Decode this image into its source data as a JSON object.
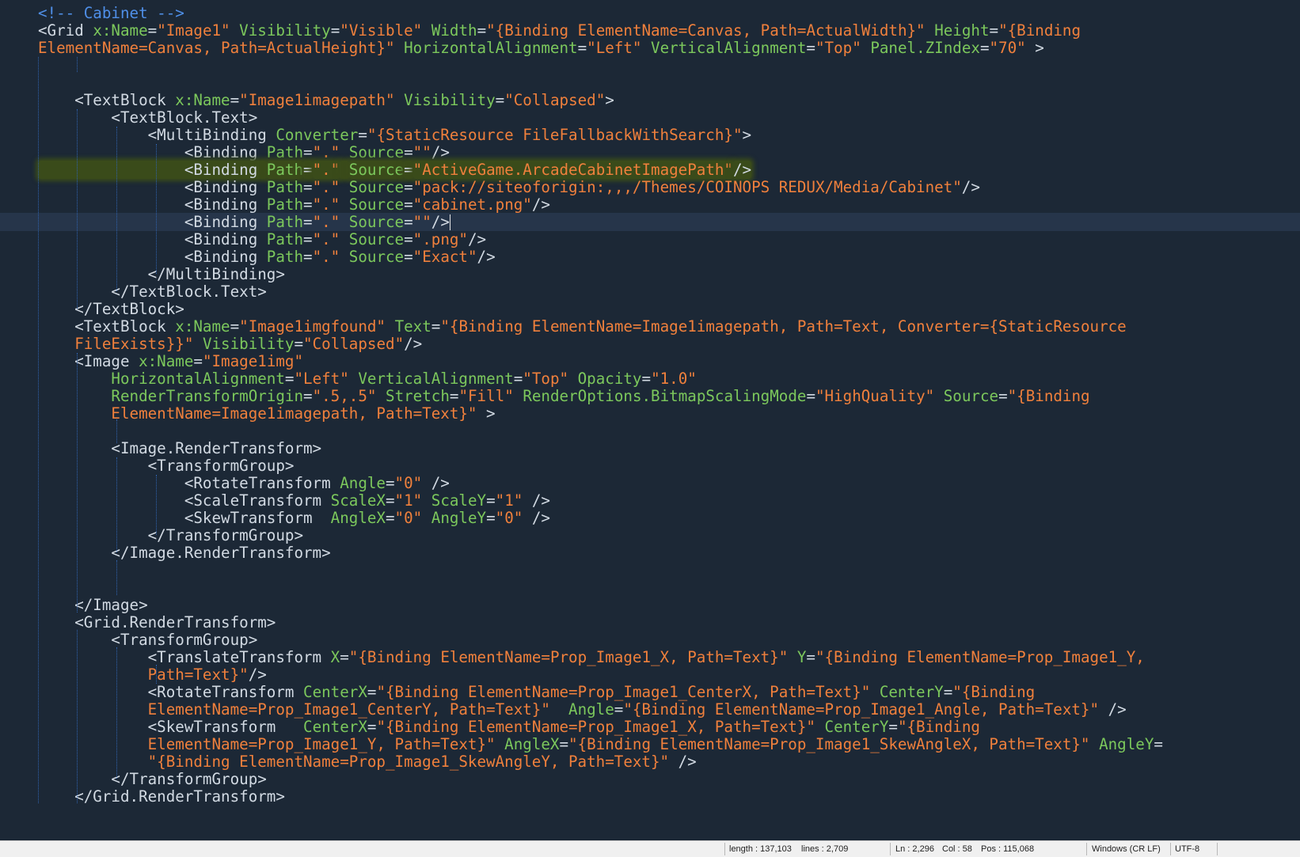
{
  "editor": {
    "lines": [
      [
        [
          "c",
          "<!-- Cabinet -->"
        ]
      ],
      [
        [
          "t",
          "<Grid "
        ],
        [
          "a",
          "x:Name"
        ],
        [
          "t",
          "="
        ],
        [
          "v",
          "\"Image1\""
        ],
        [
          "t",
          " "
        ],
        [
          "a",
          "Visibility"
        ],
        [
          "t",
          "="
        ],
        [
          "v",
          "\"Visible\""
        ],
        [
          "t",
          " "
        ],
        [
          "a",
          "Width"
        ],
        [
          "t",
          "="
        ],
        [
          "v",
          "\"{Binding ElementName=Canvas, Path=ActualWidth}\""
        ],
        [
          "t",
          " "
        ],
        [
          "a",
          "Height"
        ],
        [
          "t",
          "="
        ],
        [
          "v",
          "\"{Binding"
        ]
      ],
      [
        [
          "v",
          "ElementName=Canvas, Path=ActualHeight}\""
        ],
        [
          "t",
          " "
        ],
        [
          "a",
          "HorizontalAlignment"
        ],
        [
          "t",
          "="
        ],
        [
          "v",
          "\"Left\""
        ],
        [
          "t",
          " "
        ],
        [
          "a",
          "VerticalAlignment"
        ],
        [
          "t",
          "="
        ],
        [
          "v",
          "\"Top\""
        ],
        [
          "t",
          " "
        ],
        [
          "a",
          "Panel.ZIndex"
        ],
        [
          "t",
          "="
        ],
        [
          "v",
          "\"70\""
        ],
        [
          "t",
          " >"
        ]
      ],
      [],
      [],
      [
        [
          "t",
          "    <TextBlock "
        ],
        [
          "a",
          "x:Name"
        ],
        [
          "t",
          "="
        ],
        [
          "v",
          "\"Image1imagepath\""
        ],
        [
          "t",
          " "
        ],
        [
          "a",
          "Visibility"
        ],
        [
          "t",
          "="
        ],
        [
          "v",
          "\"Collapsed\""
        ],
        [
          "t",
          ">"
        ]
      ],
      [
        [
          "t",
          "        <TextBlock.Text>"
        ]
      ],
      [
        [
          "t",
          "            <MultiBinding "
        ],
        [
          "a",
          "Converter"
        ],
        [
          "t",
          "="
        ],
        [
          "v",
          "\"{StaticResource FileFallbackWithSearch}\""
        ],
        [
          "t",
          ">"
        ]
      ],
      [
        [
          "t",
          "                <Binding "
        ],
        [
          "a",
          "Path"
        ],
        [
          "t",
          "="
        ],
        [
          "v",
          "\".\""
        ],
        [
          "t",
          " "
        ],
        [
          "a",
          "Source"
        ],
        [
          "t",
          "="
        ],
        [
          "v",
          "\"\""
        ],
        [
          "t",
          "/>"
        ]
      ],
      [
        [
          "th",
          "                <Binding "
        ],
        [
          "ah",
          "Path"
        ],
        [
          "th",
          "="
        ],
        [
          "vh",
          "\".\""
        ],
        [
          "th",
          " "
        ],
        [
          "ah",
          "Source"
        ],
        [
          "th",
          "="
        ],
        [
          "vh",
          "\"ActiveGame.ArcadeCabinetImagePath\""
        ],
        [
          "th",
          "/>"
        ]
      ],
      [
        [
          "t",
          "                <Binding "
        ],
        [
          "a",
          "Path"
        ],
        [
          "t",
          "="
        ],
        [
          "v",
          "\".\""
        ],
        [
          "t",
          " "
        ],
        [
          "a",
          "Source"
        ],
        [
          "t",
          "="
        ],
        [
          "v",
          "\"pack://siteoforigin:,,,/Themes/COINOPS REDUX/Media/Cabinet\""
        ],
        [
          "t",
          "/>"
        ]
      ],
      [
        [
          "t",
          "                <Binding "
        ],
        [
          "a",
          "Path"
        ],
        [
          "t",
          "="
        ],
        [
          "v",
          "\".\""
        ],
        [
          "t",
          " "
        ],
        [
          "a",
          "Source"
        ],
        [
          "t",
          "="
        ],
        [
          "v",
          "\"cabinet.png\""
        ],
        [
          "t",
          "/>"
        ]
      ],
      [
        [
          "t",
          "                <Binding "
        ],
        [
          "a",
          "Path"
        ],
        [
          "t",
          "="
        ],
        [
          "v",
          "\".\""
        ],
        [
          "t",
          " "
        ],
        [
          "a",
          "Source"
        ],
        [
          "t",
          "="
        ],
        [
          "v",
          "\"\""
        ],
        [
          "t",
          "/>"
        ],
        [
          "caret",
          ""
        ]
      ],
      [
        [
          "t",
          "                <Binding "
        ],
        [
          "a",
          "Path"
        ],
        [
          "t",
          "="
        ],
        [
          "v",
          "\".\""
        ],
        [
          "t",
          " "
        ],
        [
          "a",
          "Source"
        ],
        [
          "t",
          "="
        ],
        [
          "v",
          "\".png\""
        ],
        [
          "t",
          "/>"
        ]
      ],
      [
        [
          "t",
          "                <Binding "
        ],
        [
          "a",
          "Path"
        ],
        [
          "t",
          "="
        ],
        [
          "v",
          "\".\""
        ],
        [
          "t",
          " "
        ],
        [
          "a",
          "Source"
        ],
        [
          "t",
          "="
        ],
        [
          "v",
          "\"Exact\""
        ],
        [
          "t",
          "/>"
        ]
      ],
      [
        [
          "t",
          "            </MultiBinding>"
        ]
      ],
      [
        [
          "t",
          "        </TextBlock.Text>"
        ]
      ],
      [
        [
          "t",
          "    </TextBlock>"
        ]
      ],
      [
        [
          "t",
          "    <TextBlock "
        ],
        [
          "a",
          "x:Name"
        ],
        [
          "t",
          "="
        ],
        [
          "v",
          "\"Image1imgfound\""
        ],
        [
          "t",
          " "
        ],
        [
          "a",
          "Text"
        ],
        [
          "t",
          "="
        ],
        [
          "v",
          "\"{Binding ElementName=Image1imagepath, Path=Text, Converter={StaticResource"
        ]
      ],
      [
        [
          "v",
          "    FileExists}}\""
        ],
        [
          "t",
          " "
        ],
        [
          "a",
          "Visibility"
        ],
        [
          "t",
          "="
        ],
        [
          "v",
          "\"Collapsed\""
        ],
        [
          "t",
          "/>"
        ]
      ],
      [
        [
          "t",
          "    <Image "
        ],
        [
          "a",
          "x:Name"
        ],
        [
          "t",
          "="
        ],
        [
          "v",
          "\"Image1img\""
        ]
      ],
      [
        [
          "a",
          "        HorizontalAlignment"
        ],
        [
          "t",
          "="
        ],
        [
          "v",
          "\"Left\""
        ],
        [
          "t",
          " "
        ],
        [
          "a",
          "VerticalAlignment"
        ],
        [
          "t",
          "="
        ],
        [
          "v",
          "\"Top\""
        ],
        [
          "t",
          " "
        ],
        [
          "a",
          "Opacity"
        ],
        [
          "t",
          "="
        ],
        [
          "v",
          "\"1.0\""
        ]
      ],
      [
        [
          "a",
          "        RenderTransformOrigin"
        ],
        [
          "t",
          "="
        ],
        [
          "v",
          "\".5,.5\""
        ],
        [
          "t",
          " "
        ],
        [
          "a",
          "Stretch"
        ],
        [
          "t",
          "="
        ],
        [
          "v",
          "\"Fill\""
        ],
        [
          "t",
          " "
        ],
        [
          "a",
          "RenderOptions.BitmapScalingMode"
        ],
        [
          "t",
          "="
        ],
        [
          "v",
          "\"HighQuality\""
        ],
        [
          "t",
          " "
        ],
        [
          "a",
          "Source"
        ],
        [
          "t",
          "="
        ],
        [
          "v",
          "\"{Binding"
        ]
      ],
      [
        [
          "v",
          "        ElementName=Image1imagepath, Path=Text}\""
        ],
        [
          "t",
          " >"
        ]
      ],
      [],
      [
        [
          "t",
          "        <Image.RenderTransform>"
        ]
      ],
      [
        [
          "t",
          "            <TransformGroup>"
        ]
      ],
      [
        [
          "t",
          "                <RotateTransform "
        ],
        [
          "a",
          "Angle"
        ],
        [
          "t",
          "="
        ],
        [
          "v",
          "\"0\""
        ],
        [
          "t",
          " />"
        ]
      ],
      [
        [
          "t",
          "                <ScaleTransform "
        ],
        [
          "a",
          "ScaleX"
        ],
        [
          "t",
          "="
        ],
        [
          "v",
          "\"1\""
        ],
        [
          "t",
          " "
        ],
        [
          "a",
          "ScaleY"
        ],
        [
          "t",
          "="
        ],
        [
          "v",
          "\"1\""
        ],
        [
          "t",
          " />"
        ]
      ],
      [
        [
          "t",
          "                <SkewTransform  "
        ],
        [
          "a",
          "AngleX"
        ],
        [
          "t",
          "="
        ],
        [
          "v",
          "\"0\""
        ],
        [
          "t",
          " "
        ],
        [
          "a",
          "AngleY"
        ],
        [
          "t",
          "="
        ],
        [
          "v",
          "\"0\""
        ],
        [
          "t",
          " />"
        ]
      ],
      [
        [
          "t",
          "            </TransformGroup>"
        ]
      ],
      [
        [
          "t",
          "        </Image.RenderTransform>"
        ]
      ],
      [],
      [],
      [
        [
          "t",
          "    </Image>"
        ]
      ],
      [
        [
          "t",
          "    <Grid.RenderTransform>"
        ]
      ],
      [
        [
          "t",
          "        <TransformGroup>"
        ]
      ],
      [
        [
          "t",
          "            <TranslateTransform "
        ],
        [
          "a",
          "X"
        ],
        [
          "t",
          "="
        ],
        [
          "v",
          "\"{Binding ElementName=Prop_Image1_X, Path=Text}\""
        ],
        [
          "t",
          " "
        ],
        [
          "a",
          "Y"
        ],
        [
          "t",
          "="
        ],
        [
          "v",
          "\"{Binding ElementName=Prop_Image1_Y,"
        ]
      ],
      [
        [
          "v",
          "            Path=Text}\""
        ],
        [
          "t",
          "/>"
        ]
      ],
      [
        [
          "t",
          "            <RotateTransform "
        ],
        [
          "a",
          "CenterX"
        ],
        [
          "t",
          "="
        ],
        [
          "v",
          "\"{Binding ElementName=Prop_Image1_CenterX, Path=Text}\""
        ],
        [
          "t",
          " "
        ],
        [
          "a",
          "CenterY"
        ],
        [
          "t",
          "="
        ],
        [
          "v",
          "\"{Binding"
        ]
      ],
      [
        [
          "v",
          "            ElementName=Prop_Image1_CenterY, Path=Text}\""
        ],
        [
          "t",
          "  "
        ],
        [
          "a",
          "Angle"
        ],
        [
          "t",
          "="
        ],
        [
          "v",
          "\"{Binding ElementName=Prop_Image1_Angle, Path=Text}\""
        ],
        [
          "t",
          " />"
        ]
      ],
      [
        [
          "t",
          "            <SkewTransform   "
        ],
        [
          "a",
          "CenterX"
        ],
        [
          "t",
          "="
        ],
        [
          "v",
          "\"{Binding ElementName=Prop_Image1_X, Path=Text}\""
        ],
        [
          "t",
          " "
        ],
        [
          "a",
          "CenterY"
        ],
        [
          "t",
          "="
        ],
        [
          "v",
          "\"{Binding"
        ]
      ],
      [
        [
          "v",
          "            ElementName=Prop_Image1_Y, Path=Text}\""
        ],
        [
          "t",
          " "
        ],
        [
          "a",
          "AngleX"
        ],
        [
          "t",
          "="
        ],
        [
          "v",
          "\"{Binding ElementName=Prop_Image1_SkewAngleX, Path=Text}\""
        ],
        [
          "t",
          " "
        ],
        [
          "a",
          "AngleY"
        ],
        [
          "t",
          "="
        ]
      ],
      [
        [
          "v",
          "            \"{Binding ElementName=Prop_Image1_SkewAngleY, Path=Text}\""
        ],
        [
          "t",
          " />"
        ]
      ],
      [
        [
          "t",
          "        </TransformGroup>"
        ]
      ],
      [
        [
          "t",
          "    </Grid.RenderTransform>"
        ]
      ]
    ]
  },
  "status_bar": {
    "length": "length : 137,103",
    "lines": "lines : 2,709",
    "ln": "Ln : 2,296",
    "col": "Col : 58",
    "pos": "Pos : 115,068",
    "eol": "Windows (CR LF)",
    "encoding": "UTF-8"
  },
  "colors": {
    "background": "#1c2836",
    "tag": "#d2dae3",
    "attribute": "#7cc85c",
    "value": "#f0803c",
    "comment": "#4f8fe8",
    "highlight": "#3a4b1a",
    "current_line": "#26354a"
  }
}
